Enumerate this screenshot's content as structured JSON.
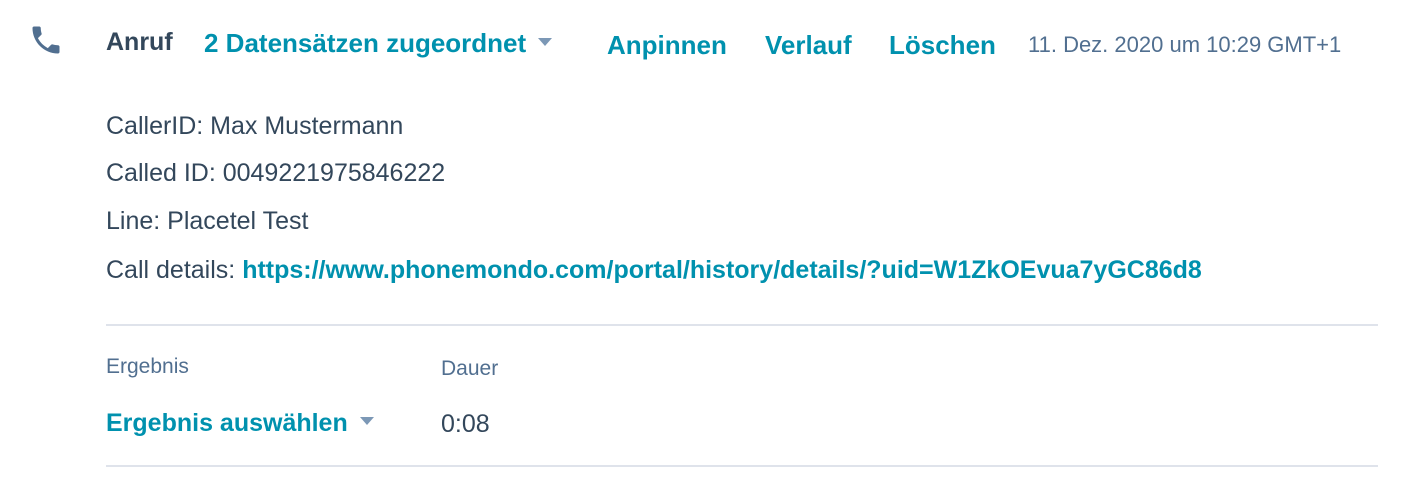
{
  "header": {
    "icon": "phone-icon",
    "type_label": "Anruf",
    "association_label": "2 Datensätzen zugeordnet",
    "actions": {
      "pin": "Anpinnen",
      "history": "Verlauf",
      "delete": "Löschen"
    },
    "timestamp": "11. Dez. 2020 um 10:29 GMT+1"
  },
  "body": {
    "caller_id": "CallerID: Max Mustermann",
    "called_id": "Called ID: 0049221975846222",
    "line": "Line: Placetel Test",
    "call_details_label": "Call details:",
    "call_details_link": "https://www.phonemondo.com/portal/history/details/?uid=W1ZkOEvua7yGC86d8"
  },
  "fields": {
    "outcome": {
      "label": "Ergebnis",
      "value": "Ergebnis auswählen"
    },
    "duration": {
      "label": "Dauer",
      "value": "0:08"
    }
  },
  "colors": {
    "link": "#0091ae",
    "text": "#33475b",
    "muted": "#516f90",
    "icon": "#516f90",
    "divider": "#dfe3eb"
  }
}
